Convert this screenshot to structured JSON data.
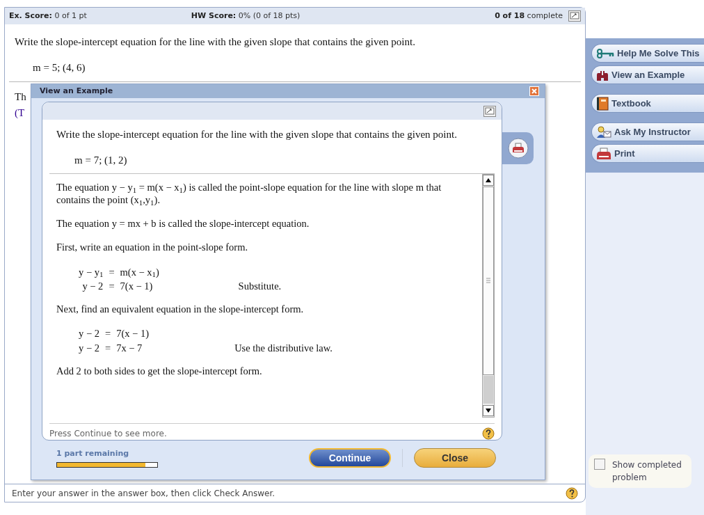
{
  "header": {
    "ex_score_label": "Ex. Score:",
    "ex_score": "0 of 1 pt",
    "hw_score_label": "HW Score:",
    "hw_score": "0% (0 of 18 pts)",
    "complete_count": "0 of 18",
    "complete_label": "complete"
  },
  "question": {
    "text": "Write the slope-intercept equation for the line with the given slope that contains the given point.",
    "given": "m = 5; (4, 6)"
  },
  "answer_fragments": [
    "Th",
    "(T"
  ],
  "instruction": "Enter your answer in the answer box, then click Check Answer.",
  "tools": [
    {
      "label": "Help Me Solve This",
      "kind": "key"
    },
    {
      "label": "View an Example",
      "kind": "binoculars"
    },
    {
      "label": "Textbook",
      "kind": "book"
    },
    {
      "label": "Ask My Instructor",
      "kind": "person"
    },
    {
      "label": "Print",
      "kind": "printer"
    }
  ],
  "show_completed": {
    "label": "Show completed problem",
    "checked": false
  },
  "example_dialog": {
    "title": "View an Example",
    "question": "Write the slope-intercept equation for the line with the given slope that contains the given point.",
    "given": "m = 7; (1, 2)",
    "blocks": [
      {
        "kind": "paragraph",
        "text": "The equation y − y$_{1}$ = m(x − x$_{1}$) is called the point-slope equation for the line with slope m that contains the point (x$_{1}$,y$_{1}$)."
      },
      {
        "kind": "paragraph",
        "text": "The equation y = mx + b is called the slope-intercept equation."
      },
      {
        "kind": "paragraph",
        "text": "First, write an equation in the point-slope form."
      },
      {
        "kind": "equations",
        "rows": [
          {
            "lhs": "y − y$_{1}$",
            "relation": "=",
            "rhs": "m(x − x$_{1}$)"
          },
          {
            "lhs": "y − 2",
            "relation": "=",
            "rhs": "7(x − 1)",
            "note": "Substitute."
          }
        ]
      },
      {
        "kind": "paragraph",
        "text": "Next, find an equivalent equation in the slope-intercept form."
      },
      {
        "kind": "equations",
        "rows": [
          {
            "lhs": "y − 2",
            "relation": "=",
            "rhs": "7(x − 1)"
          },
          {
            "lhs": "y − 2",
            "relation": "=",
            "rhs": "7x − 7",
            "note": "Use the distributive law."
          }
        ]
      },
      {
        "kind": "paragraph",
        "text": "Add 2 to both sides to get the slope-intercept form."
      }
    ],
    "footer_hint": "Press Continue to see more.",
    "progress": {
      "label": "1 part remaining",
      "level": 0.88
    },
    "buttons": [
      {
        "label": "Continue",
        "kind": "primary"
      },
      {
        "label": "Close",
        "kind": "secondary"
      }
    ]
  }
}
